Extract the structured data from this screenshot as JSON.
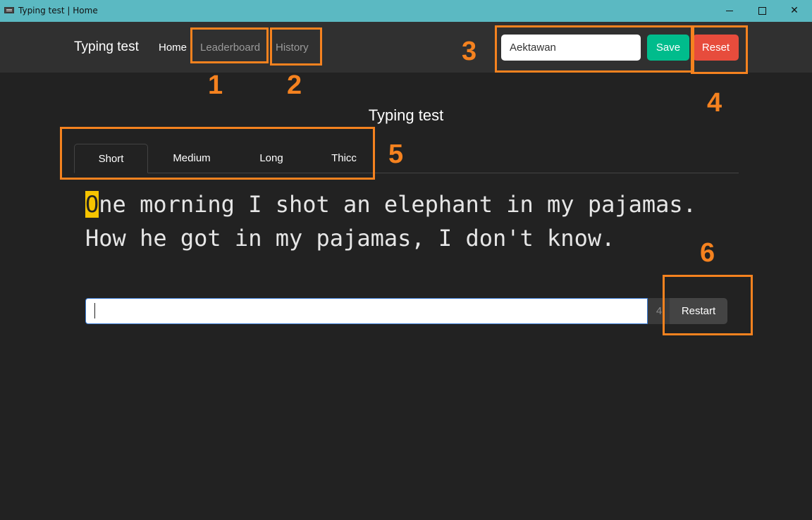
{
  "window": {
    "title": "Typing test | Home",
    "icon": "keyboard-icon",
    "controls": {
      "minimize": "minimize-icon",
      "maximize": "maximize-icon",
      "close": "✕"
    }
  },
  "navbar": {
    "brand": "Typing test",
    "links": [
      "Home",
      "Leaderboard",
      "History"
    ],
    "name_value": "Aektawan",
    "save_label": "Save",
    "reset_label": "Reset"
  },
  "main": {
    "heading": "Typing test",
    "tabs": [
      "Short",
      "Medium",
      "Long",
      "Thicc"
    ],
    "active_tab": "Short",
    "quote_first_char": "O",
    "quote_rest": "ne morning I shot an elephant in my pajamas. How he got in my pajamas, I don't know.",
    "input_value": "",
    "counter": "4",
    "restart_label": "Restart"
  },
  "annotations": [
    "1",
    "2",
    "3",
    "4",
    "5",
    "6"
  ],
  "colors": {
    "titlebar": "#5bb9c2",
    "navbar": "#303030",
    "background": "#222222",
    "save": "#00bc8c",
    "reset": "#e74c3c",
    "highlight": "#f6c400",
    "annotation": "#f5821f"
  }
}
